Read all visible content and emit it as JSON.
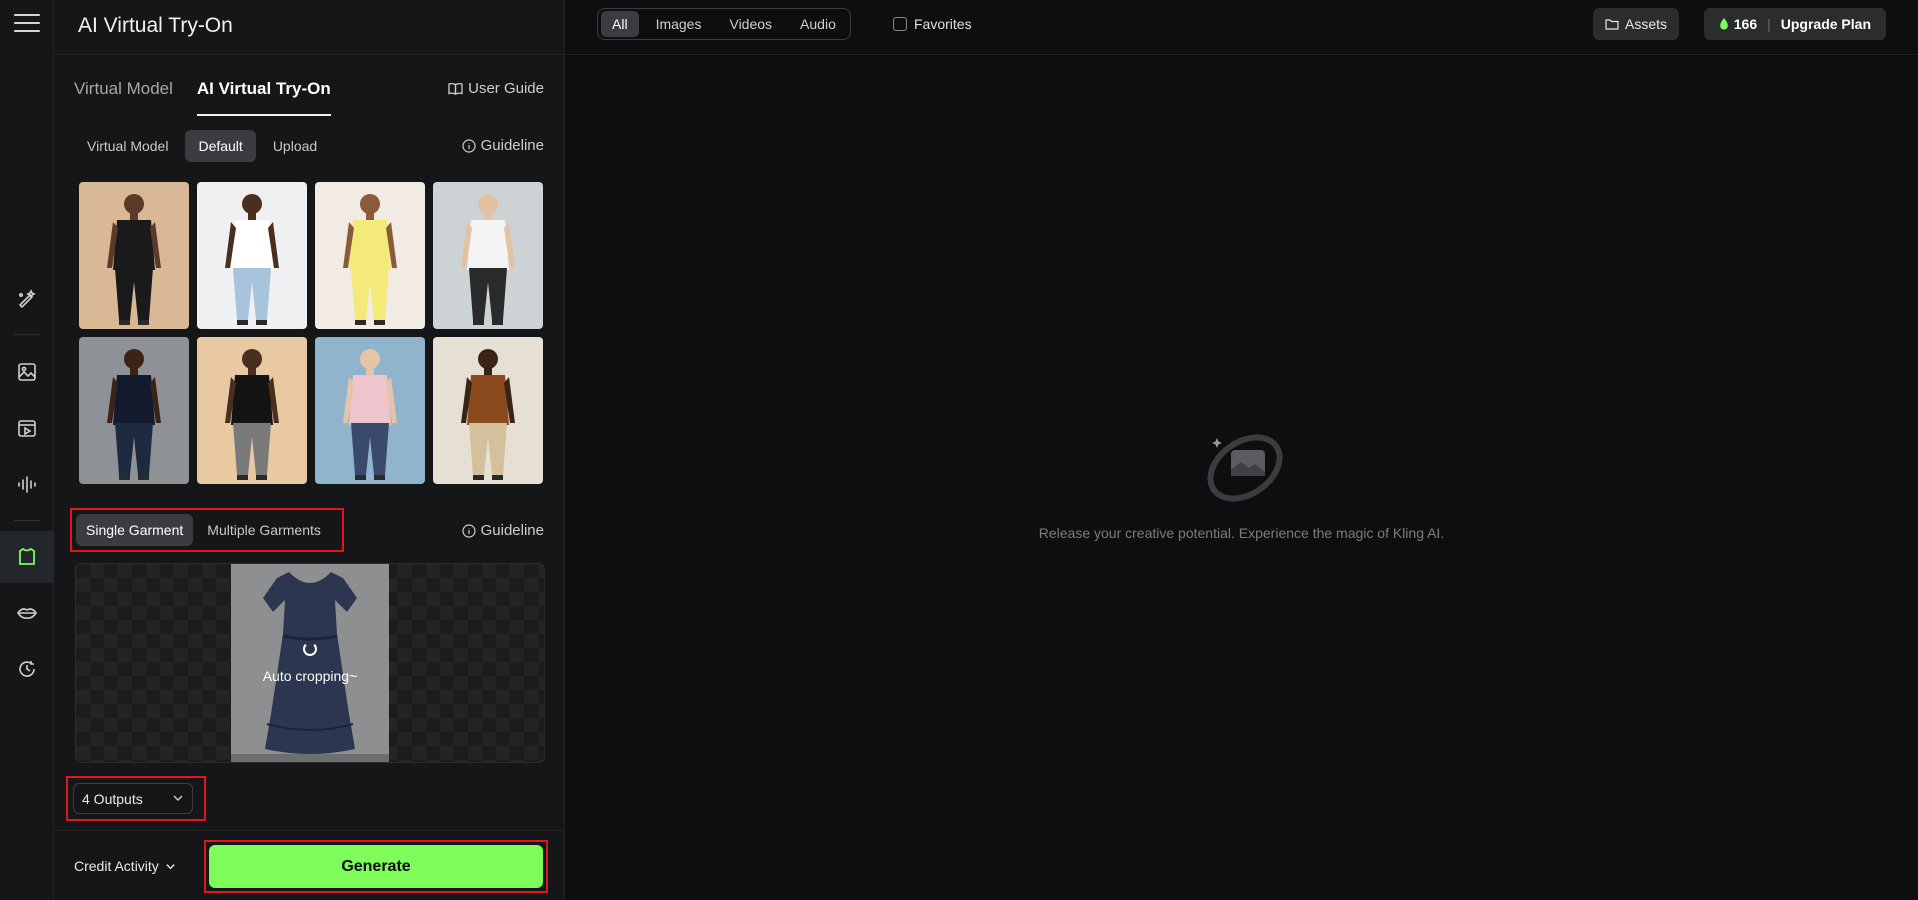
{
  "app_title": "AI Virtual Try-On",
  "rail": {
    "icons": [
      "magic-brush-icon",
      "image-icon",
      "video-icon",
      "audio-wave-icon",
      "tryon-icon",
      "lips-icon",
      "history-icon"
    ]
  },
  "tabs": {
    "virtual_model": "Virtual Model",
    "try_on": "AI Virtual Try-On",
    "user_guide": "User Guide"
  },
  "model_source": {
    "virtual_model": "Virtual Model",
    "default": "Default",
    "upload": "Upload",
    "guideline": "Guideline"
  },
  "models": [
    {
      "label": "model-1",
      "bg": "#d9b896",
      "top": "#1a1a1a",
      "bottom": "#1a1a1a",
      "skin": "#5a3a28"
    },
    {
      "label": "model-2",
      "bg": "#eef0f2",
      "top": "#ffffff",
      "bottom": "#a8c4dc",
      "skin": "#4a2e1e"
    },
    {
      "label": "model-3",
      "bg": "#f2ebe3",
      "top": "#f4ea7a",
      "bottom": "#f4ea7a",
      "skin": "#8a5a3a"
    },
    {
      "label": "model-4",
      "bg": "#cdd3d4",
      "top": "#f4f4f4",
      "bottom": "#2a2a2a",
      "skin": "#e2c2a2"
    },
    {
      "label": "model-5",
      "bg": "#8e9196",
      "top": "#141a2e",
      "bottom": "#1e2a40",
      "skin": "#3a2418"
    },
    {
      "label": "model-6",
      "bg": "#e8c9a2",
      "top": "#141414",
      "bottom": "#7a7a7a",
      "skin": "#4a2e1e"
    },
    {
      "label": "model-7",
      "bg": "#8fb4cc",
      "top": "#f0c4cc",
      "bottom": "#3a4a6a",
      "skin": "#e6c4a8"
    },
    {
      "label": "model-8",
      "bg": "#e6e0d4",
      "top": "#8a4a1e",
      "bottom": "#d4c09a",
      "skin": "#3a2418"
    }
  ],
  "garment": {
    "single": "Single Garment",
    "multiple": "Multiple Garments",
    "guideline": "Guideline",
    "status": "Auto cropping~"
  },
  "outputs": {
    "value": "4 Outputs"
  },
  "footer": {
    "credit_activity": "Credit Activity",
    "generate": "Generate"
  },
  "topbar": {
    "filters": [
      "All",
      "Images",
      "Videos",
      "Audio"
    ],
    "favorites": "Favorites",
    "assets": "Assets",
    "credits": "166",
    "upgrade": "Upgrade Plan"
  },
  "empty_state": {
    "message": "Release your creative potential. Experience the magic of Kling AI."
  },
  "colors": {
    "accent_green": "#7dfc5a",
    "highlight_red": "#e0161c"
  }
}
